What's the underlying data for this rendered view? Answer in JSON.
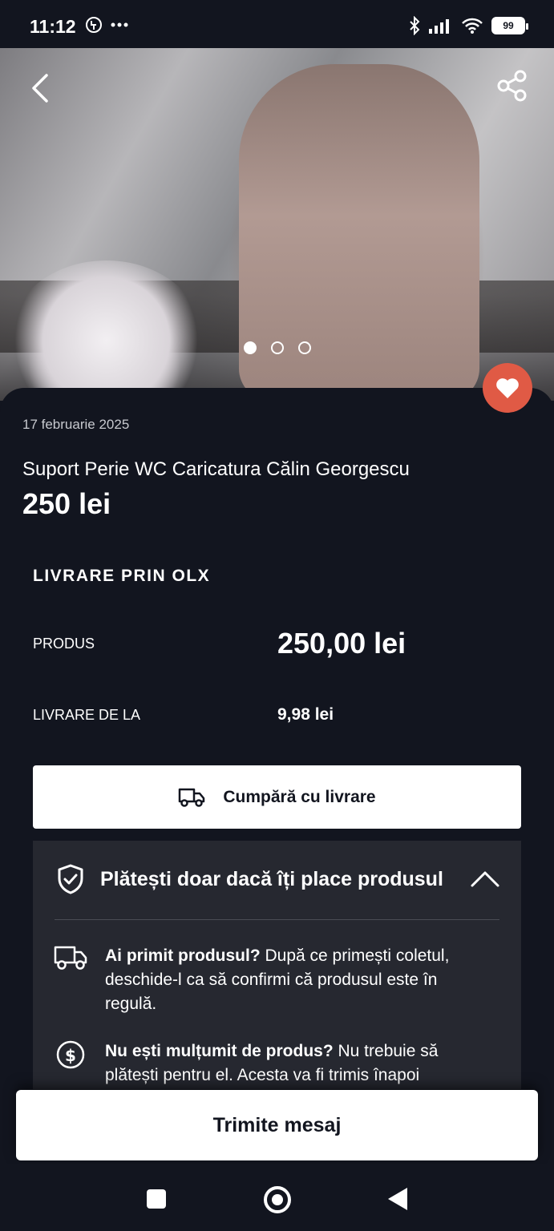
{
  "status_bar": {
    "time": "11:12",
    "battery": "99"
  },
  "gallery": {
    "image_count": 3,
    "active_index": 0
  },
  "listing": {
    "date": "17 februarie 2025",
    "title": "Suport Perie WC Caricatura Călin Georgescu",
    "price": "250 lei"
  },
  "shipping": {
    "heading": "LIVRARE PRIN OLX",
    "product_label": "PRODUS",
    "product_value": "250,00 lei",
    "delivery_label": "LIVRARE DE LA",
    "delivery_value": "9,98 lei",
    "buy_button": "Cumpără cu livrare"
  },
  "protection": {
    "title": "Plătești doar dacă îți place produsul",
    "items": [
      {
        "bold": "Ai primit produsul?",
        "text": " După ce primești coletul, deschide-l ca să confirmi că produsul este în regulă.",
        "icon": "truck-icon"
      },
      {
        "bold": "Nu ești mulțumit de produs?",
        "text": " Nu trebuie să plătești pentru el. Acesta va fi trimis înapoi",
        "icon": "dollar-circle-icon"
      }
    ]
  },
  "message_button": "Trimite mesaj",
  "colors": {
    "background": "#12151f",
    "favorite": "#e05a45",
    "panel": "#262830"
  }
}
